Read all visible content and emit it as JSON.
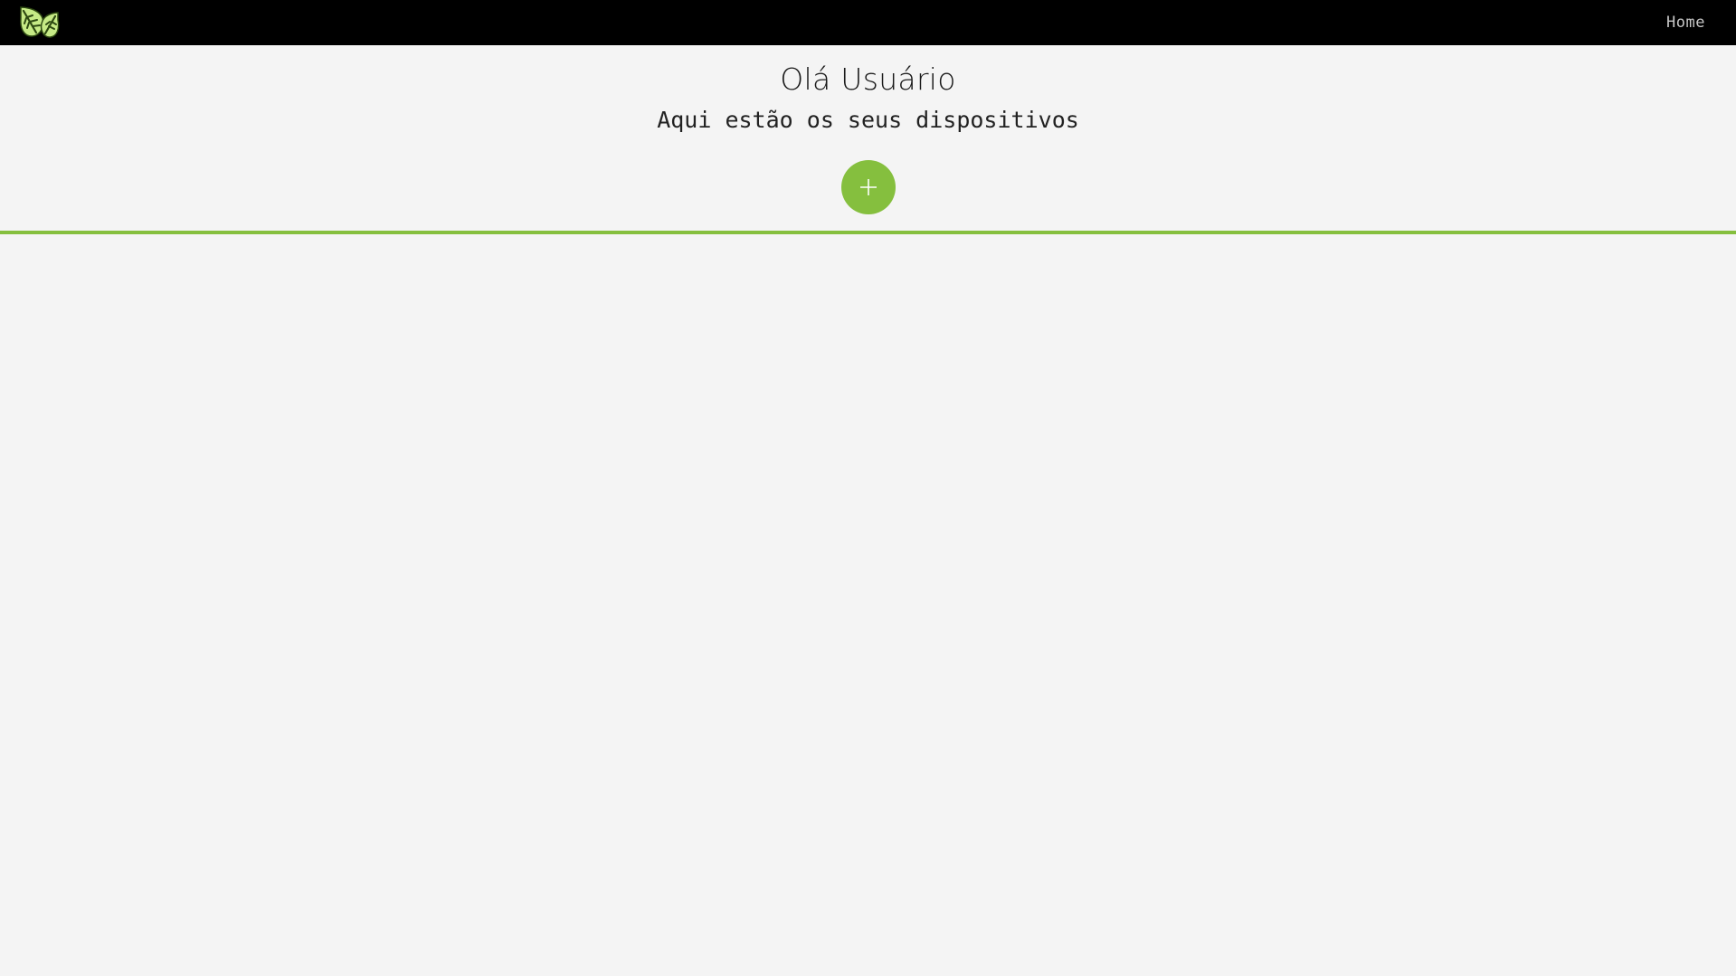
{
  "navbar": {
    "logo_icon": "leaf-logo-icon",
    "home_label": "Home"
  },
  "header": {
    "greeting": "Olá Usuário",
    "subtitle": "Aqui estão os seus dispositivos"
  },
  "add_button": {
    "icon": "plus-icon"
  },
  "colors": {
    "accent": "#85bf3e",
    "navbar_bg": "#000000",
    "page_bg": "#f4f4f4",
    "logo_light": "#c6ea86",
    "logo_dark": "#2e4a12"
  },
  "devices": []
}
